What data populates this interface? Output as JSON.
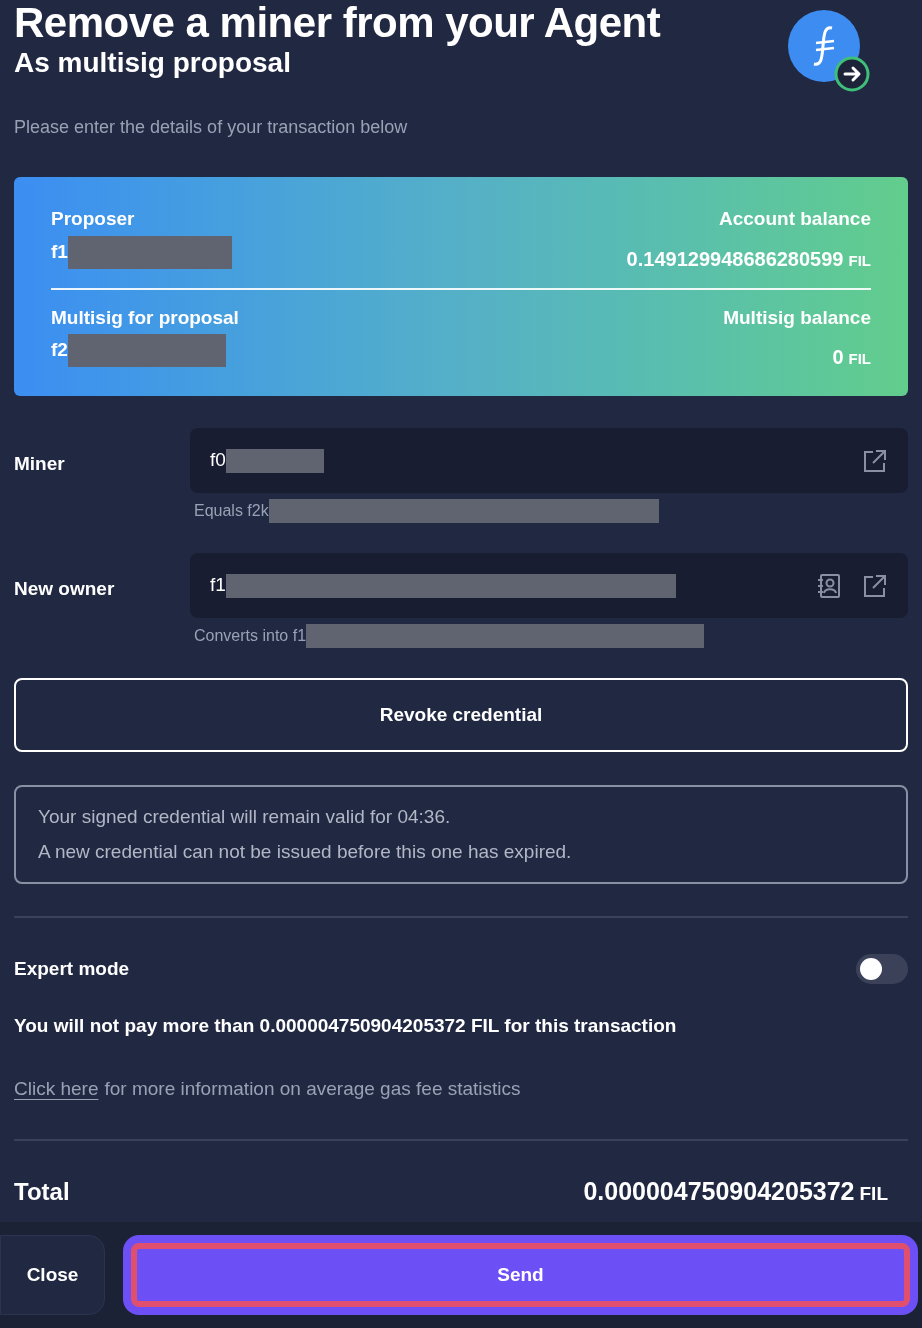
{
  "header": {
    "title": "Remove a miner from your Agent",
    "subtitle": "As multisig proposal",
    "hint": "Please enter the details of your transaction below"
  },
  "summary": {
    "proposer_label": "Proposer",
    "proposer": "f1",
    "account_balance_label": "Account balance",
    "account_balance": "0.149129948686280599",
    "account_unit": "FIL",
    "multisig_label": "Multisig for proposal",
    "multisig": "f2",
    "multisig_balance_label": "Multisig balance",
    "multisig_balance": "0",
    "multisig_unit": "FIL"
  },
  "fields": [
    {
      "label": "Miner",
      "value": "f0",
      "address_book": false,
      "note": "Equals f2k"
    },
    {
      "label": "New owner",
      "value": "f1",
      "address_book": true,
      "note": "Converts into f1"
    }
  ],
  "revoke_button": "Revoke credential",
  "credential_info": [
    "Your signed credential will remain valid for 04:36.",
    "A new credential can not be issued before this one has expired."
  ],
  "expert_mode": {
    "label": "Expert mode",
    "on": false
  },
  "fee_note": "You will not pay more than 0.000004750904205372 FIL for this transaction",
  "gas_link": {
    "link": "Click here",
    "rest": "for more information on average gas fee statistics"
  },
  "total": {
    "label": "Total",
    "value": "0.000004750904205372",
    "unit": "FIL"
  },
  "footer": {
    "close": "Close",
    "send": "Send",
    "send_highlighted": true
  }
}
